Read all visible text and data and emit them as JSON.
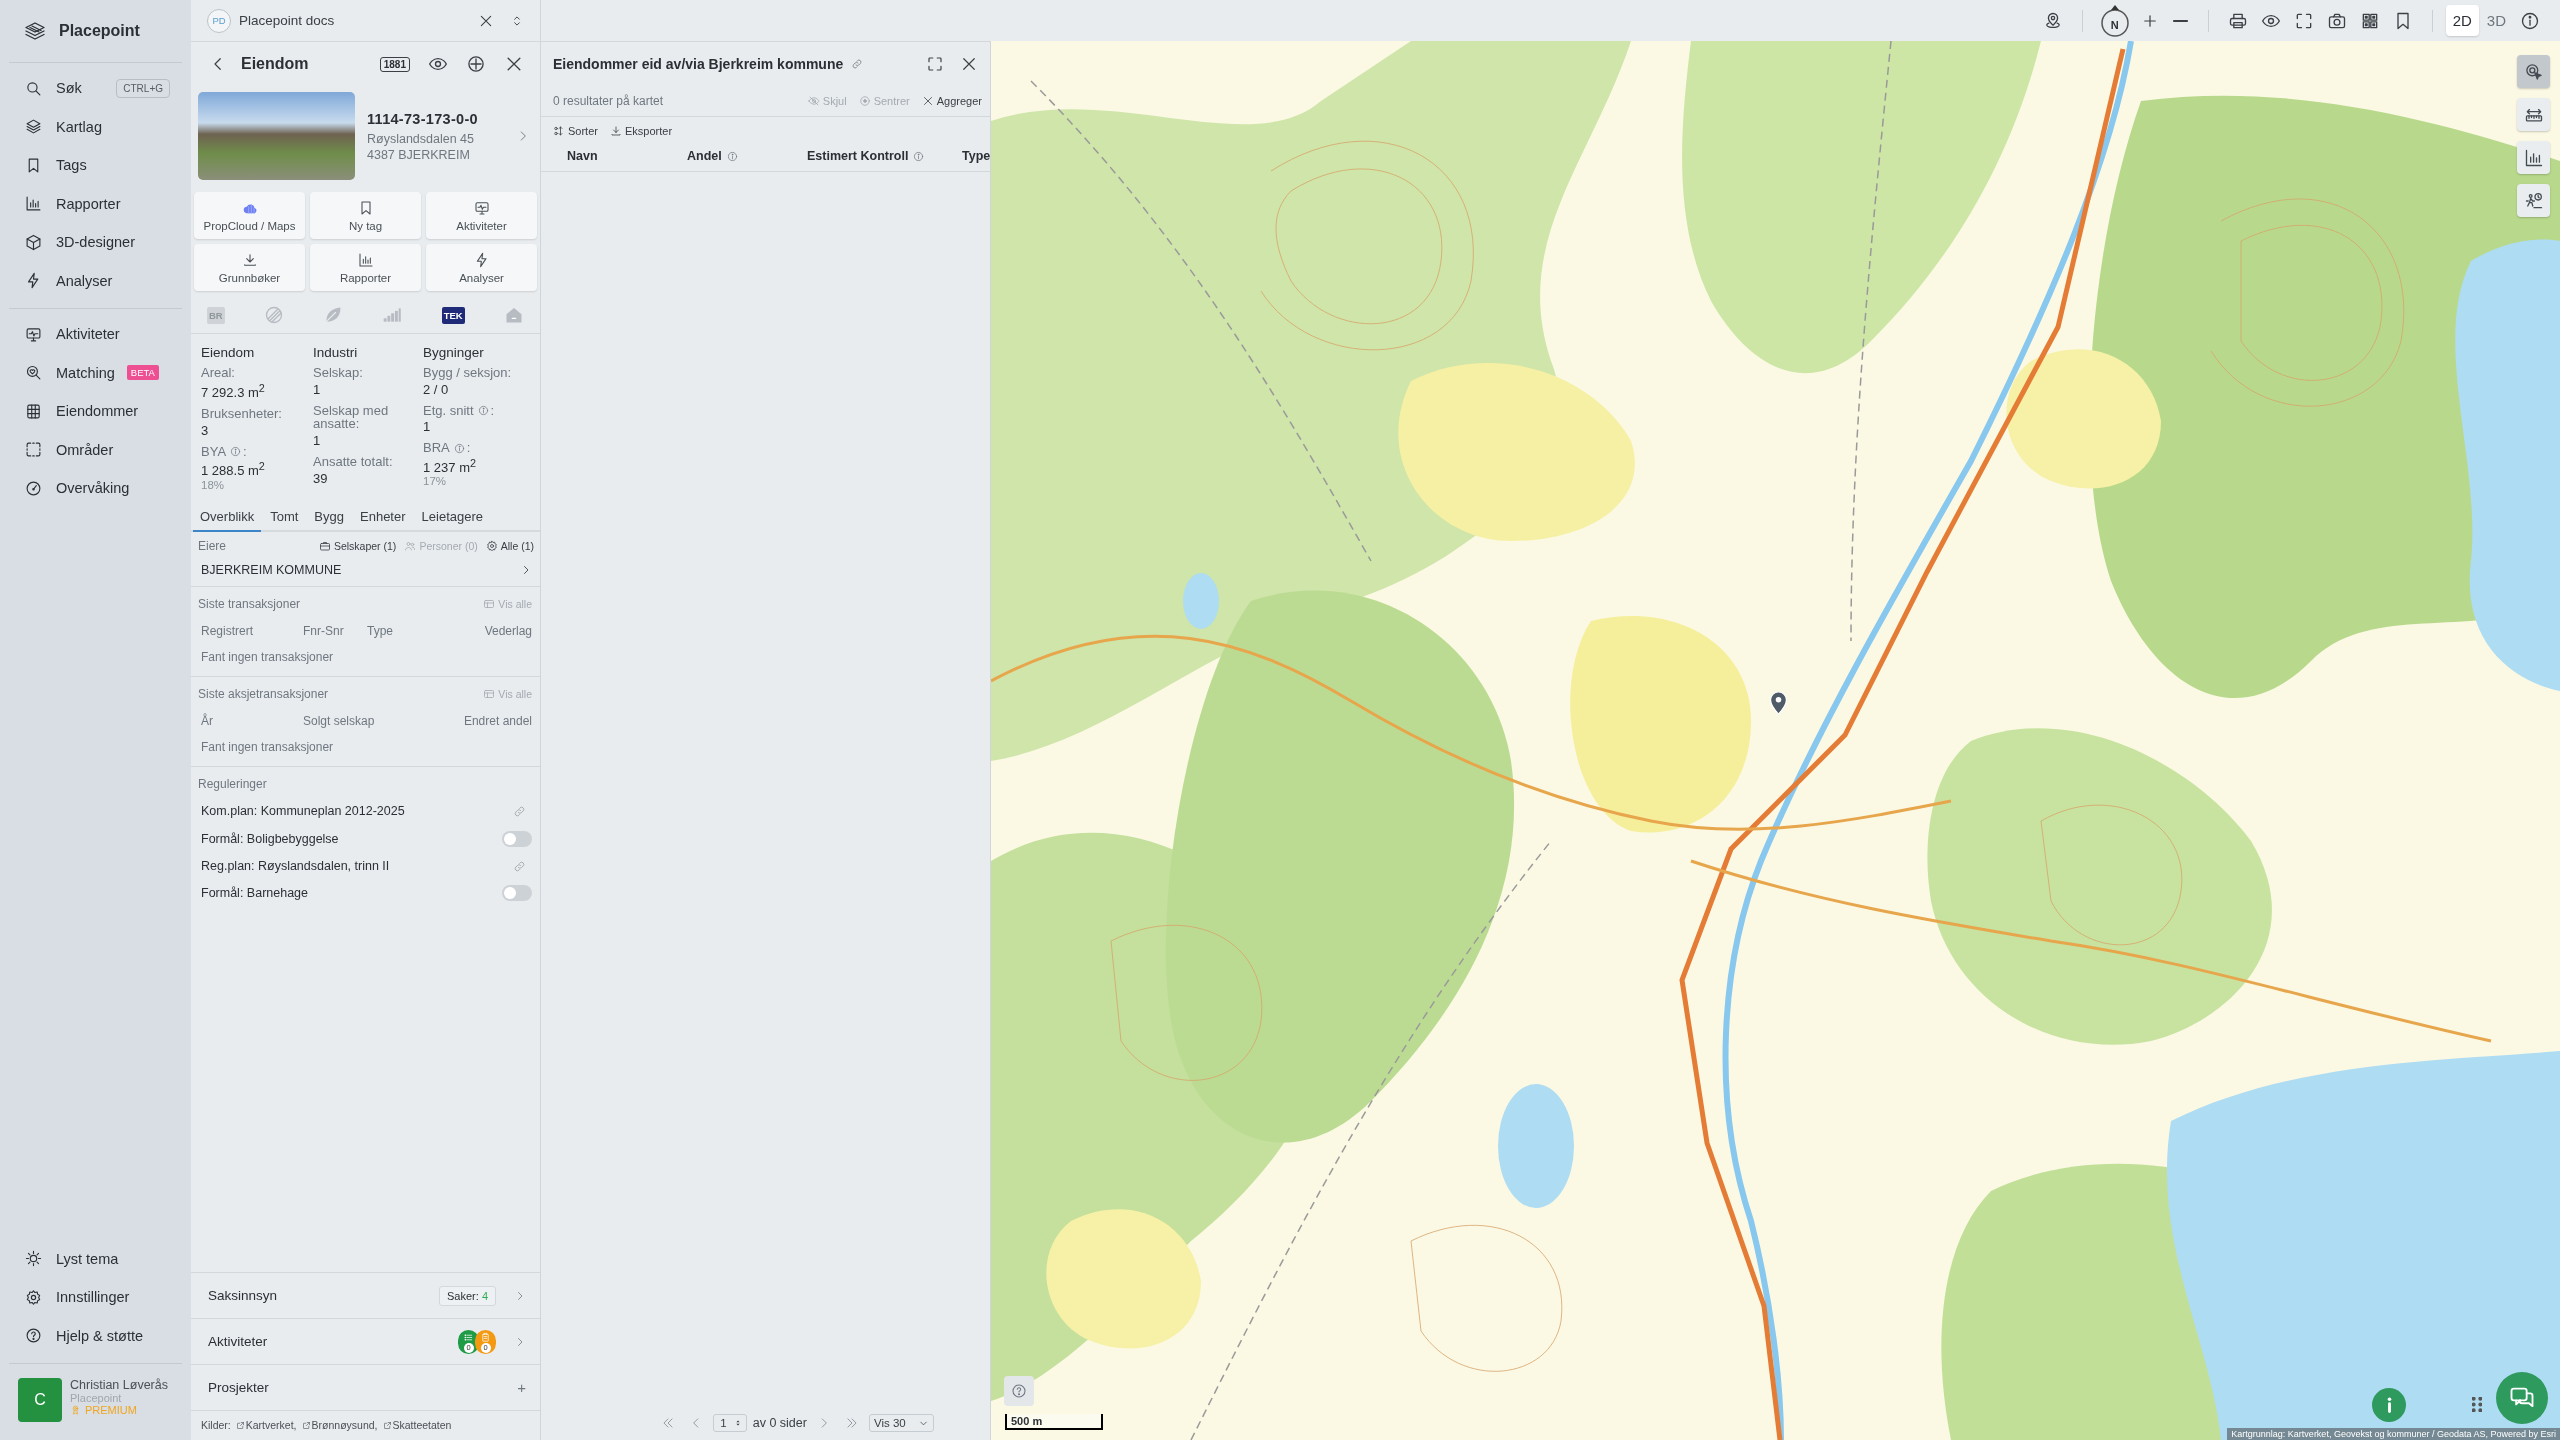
{
  "workspace": {
    "initials": "PD",
    "name": "Placepoint docs"
  },
  "sidebar": {
    "brand": "Placepoint",
    "groups": [
      [
        {
          "label": "Søk",
          "shortcut": "CTRL+G",
          "selected": false
        },
        {
          "label": "Kartlag",
          "selected": false
        },
        {
          "label": "Tags",
          "selected": false
        },
        {
          "label": "Rapporter",
          "selected": false
        },
        {
          "label": "3D-designer",
          "selected": false
        },
        {
          "label": "Analyser",
          "selected": false
        }
      ],
      [
        {
          "label": "Aktiviteter",
          "selected": false
        },
        {
          "label": "Matching",
          "badge": "BETA",
          "selected": false
        },
        {
          "label": "Eiendommer",
          "selected": false
        },
        {
          "label": "Områder",
          "selected": false
        },
        {
          "label": "Overvåking",
          "selected": false
        }
      ]
    ],
    "footer_items": [
      {
        "label": "Lyst tema",
        "selected": false
      },
      {
        "label": "Innstillinger",
        "selected": false
      },
      {
        "label": "Hjelp & støtte",
        "selected": false
      }
    ],
    "user": {
      "initial": "C",
      "name": "Christian Løverås",
      "org": "Placepoint",
      "plan": "PREMIUM"
    }
  },
  "property": {
    "title": "Eiendom",
    "directory_badge": "1881",
    "id": "1114-73-173-0-0",
    "address": [
      "Røyslandsdalen 45",
      "4387 BJERKREIM"
    ],
    "actions": [
      "PropCloud / Maps",
      "Ny tag",
      "Aktiviteter",
      "Grunnbøker",
      "Rapporter",
      "Analyser"
    ],
    "sources": [
      {
        "kind": "badge",
        "text": "BR",
        "active": false
      },
      {
        "kind": "icon",
        "active": false
      },
      {
        "kind": "icon",
        "active": false
      },
      {
        "kind": "icon",
        "active": false
      },
      {
        "kind": "badge",
        "text": "TEK",
        "active": true
      },
      {
        "kind": "icon",
        "active": false
      }
    ],
    "stats": [
      {
        "heading": "Eiendom",
        "fields": [
          {
            "label": "Areal:",
            "value": "7 292.3 m$^{2}$"
          },
          {
            "label": "Bruksenheter:",
            "value": "3"
          },
          {
            "label": "BYA",
            "info": true,
            "label_end": ":",
            "value": "1 288.5 m$^{2}$",
            "share": "18%"
          }
        ]
      },
      {
        "heading": "Industri",
        "fields": [
          {
            "label": "Selskap:",
            "value": "1"
          },
          {
            "label": "Selskap med ansatte:",
            "value": "1"
          },
          {
            "label": "Ansatte totalt:",
            "value": "39"
          }
        ]
      },
      {
        "heading": "Bygninger",
        "fields": [
          {
            "label": "Bygg / seksjon:",
            "value": "2 / 0"
          },
          {
            "label": "Etg. snitt",
            "info": true,
            "label_end": ":",
            "value": "1"
          },
          {
            "label": "BRA",
            "info": true,
            "label_end": ":",
            "value": "1 237 m$^{2}$",
            "share": "17%"
          }
        ]
      }
    ],
    "tabs": [
      {
        "label": "Overblikk",
        "selected": true
      },
      {
        "label": "Tomt",
        "selected": false
      },
      {
        "label": "Bygg",
        "selected": false
      },
      {
        "label": "Enheter",
        "selected": false
      },
      {
        "label": "Leietagere",
        "selected": false
      }
    ],
    "owners": {
      "label": "Eiere",
      "filters": [
        {
          "label": "Selskaper (1)",
          "disabled": false
        },
        {
          "label": "Personer (0)",
          "disabled": true
        },
        {
          "label": "Alle (1)",
          "disabled": false
        }
      ],
      "items": [
        "BJERKREIM KOMMUNE"
      ]
    },
    "transactions": {
      "title": "Siste transaksjoner",
      "view_all": {
        "label": "Vis alle",
        "disabled": true
      },
      "columns": [
        "Registrert",
        "Fnr-Snr",
        "Type",
        "Vederlag"
      ],
      "empty": "Fant ingen transaksjoner"
    },
    "share_transactions": {
      "title": "Siste aksjetransaksjoner",
      "view_all": {
        "label": "Vis alle",
        "disabled": true
      },
      "columns": [
        "År",
        "Solgt selskap",
        "Endret andel"
      ],
      "empty": "Fant ingen transaksjoner"
    },
    "regulations": {
      "title": "Reguleringer",
      "items": [
        {
          "kind": "link",
          "label": "Kom.plan: Kommuneplan 2012-2025"
        },
        {
          "kind": "toggle",
          "label": "Formål: Boligbebyggelse",
          "on": false
        },
        {
          "kind": "link",
          "label": "Reg.plan: Røyslandsdalen, trinn II"
        },
        {
          "kind": "toggle",
          "label": "Formål: Barnehage",
          "on": false
        }
      ]
    },
    "sections": [
      {
        "kind": "count",
        "label": "Saksinnsyn",
        "chip_label": "Saker:",
        "chip_value": "4"
      },
      {
        "kind": "activities",
        "label": "Aktiviteter",
        "badges": [
          {
            "count": "0",
            "color": "#1f9a45"
          },
          {
            "count": "0",
            "color": "#f39a12"
          }
        ]
      },
      {
        "kind": "add",
        "label": "Prosjekter",
        "action": "+"
      }
    ],
    "sources_footer": {
      "label": "Kilder:",
      "links": [
        "Kartverket,",
        "Brønnøysund,",
        "Skatteetaten"
      ]
    }
  },
  "results": {
    "title": "Eiendommer eid av/via Bjerkreim kommune",
    "result_count": "0 resultater på kartet",
    "actions": [
      {
        "label": "Skjul",
        "disabled": true
      },
      {
        "label": "Sentrer",
        "disabled": true
      },
      {
        "label": "Aggreger",
        "disabled": false
      }
    ],
    "tools": [
      "Sorter",
      "Eksporter"
    ],
    "columns": [
      {
        "label": "Navn"
      },
      {
        "label": "Andel",
        "info": true
      },
      {
        "label": "Estimert Kontroll",
        "info": true
      },
      {
        "label": "Type"
      }
    ],
    "pagination": {
      "page": "1",
      "of_pages": "av 0 sider",
      "page_size": "Vis 30"
    }
  },
  "map": {
    "compass_label": "N",
    "view_modes": [
      {
        "label": "2D",
        "selected": true
      },
      {
        "label": "3D",
        "selected": false
      }
    ],
    "side_tools": [
      {
        "selected": true
      },
      {
        "selected": false
      },
      {
        "selected": false
      },
      {
        "selected": false
      }
    ],
    "scale": "500 m",
    "attribution": "Kartgrunnlag: Kartverket, Geovekst og kommuner / Geodata AS, Powered by Esri"
  }
}
